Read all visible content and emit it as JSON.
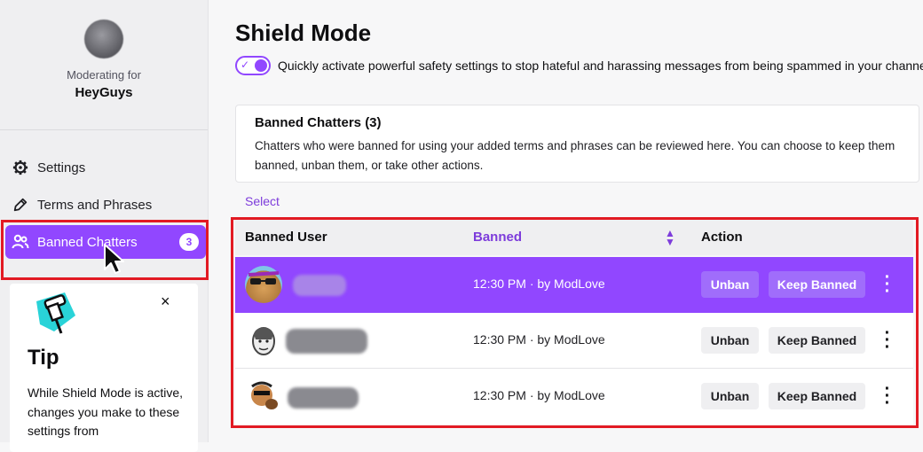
{
  "sidebar": {
    "moderating_label": "Moderating for",
    "channel_name": "HeyGuys",
    "items": [
      {
        "label": "Settings",
        "icon": "gear-icon"
      },
      {
        "label": "Terms and Phrases",
        "icon": "pencil-icon"
      },
      {
        "label": "Banned Chatters",
        "icon": "users-icon",
        "badge": "3",
        "active": true
      }
    ]
  },
  "tip": {
    "title": "Tip",
    "body": "While Shield Mode is active, changes you make to these settings from",
    "close": "×"
  },
  "main": {
    "title": "Shield Mode",
    "toggle_on": true,
    "toggle_description": "Quickly activate powerful safety settings to stop hateful and harassing messages from being spammed in your channel.",
    "card": {
      "title": "Banned Chatters (3)",
      "description": "Chatters who were banned for using your added terms and phrases can be reviewed here. You can choose to keep them banned, unban them, or take other actions."
    },
    "select_label": "Select",
    "table": {
      "headers": {
        "user": "Banned User",
        "banned": "Banned",
        "action": "Action"
      },
      "rows": [
        {
          "time": "12:30 PM",
          "by": " · by ModLove",
          "unban": "Unban",
          "keep": "Keep Banned",
          "highlighted": true
        },
        {
          "time": "12:30 PM",
          "by": " · by ModLove",
          "unban": "Unban",
          "keep": "Keep Banned",
          "highlighted": false
        },
        {
          "time": "12:30 PM",
          "by": " · by ModLove",
          "unban": "Unban",
          "keep": "Keep Banned",
          "highlighted": false
        }
      ]
    }
  },
  "colors": {
    "accent": "#9147ff",
    "highlight_box": "#e21a23",
    "sidebar_bg": "#efeff1"
  }
}
